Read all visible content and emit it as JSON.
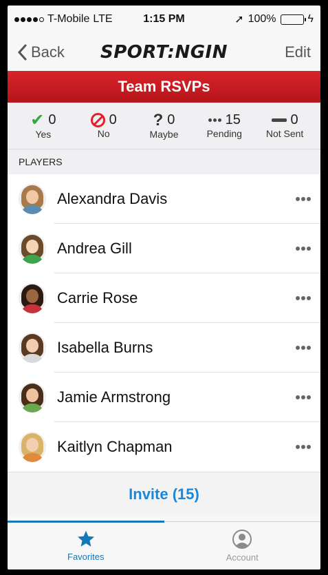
{
  "status_bar": {
    "carrier": "T-Mobile",
    "network": "LTE",
    "time": "1:15 PM",
    "battery": "100%"
  },
  "nav": {
    "back_label": "Back",
    "logo_text": "SPORT:NGIN",
    "edit_label": "Edit"
  },
  "title": "Team RSVPs",
  "counts": [
    {
      "icon": "check-icon",
      "value": "0",
      "label": "Yes"
    },
    {
      "icon": "no-icon",
      "value": "0",
      "label": "No"
    },
    {
      "icon": "question-icon",
      "value": "0",
      "label": "Maybe"
    },
    {
      "icon": "dots-icon",
      "value": "15",
      "label": "Pending"
    },
    {
      "icon": "dash-icon",
      "value": "0",
      "label": "Not Sent"
    }
  ],
  "section_label": "PLAYERS",
  "players": [
    {
      "name": "Alexandra Davis"
    },
    {
      "name": "Andrea Gill"
    },
    {
      "name": "Carrie Rose"
    },
    {
      "name": "Isabella Burns"
    },
    {
      "name": "Jamie Armstrong"
    },
    {
      "name": "Kaitlyn Chapman"
    }
  ],
  "invite_label": "Invite (15)",
  "tabs": [
    {
      "label": "Favorites",
      "icon": "star-icon",
      "active": true
    },
    {
      "label": "Account",
      "icon": "account-icon",
      "active": false
    }
  ],
  "colors": {
    "title_red": "#c81c22",
    "accent_blue": "#1478b6",
    "invite_blue": "#1a87d8",
    "yes_green": "#2eab3c",
    "no_red": "#e0212b"
  }
}
